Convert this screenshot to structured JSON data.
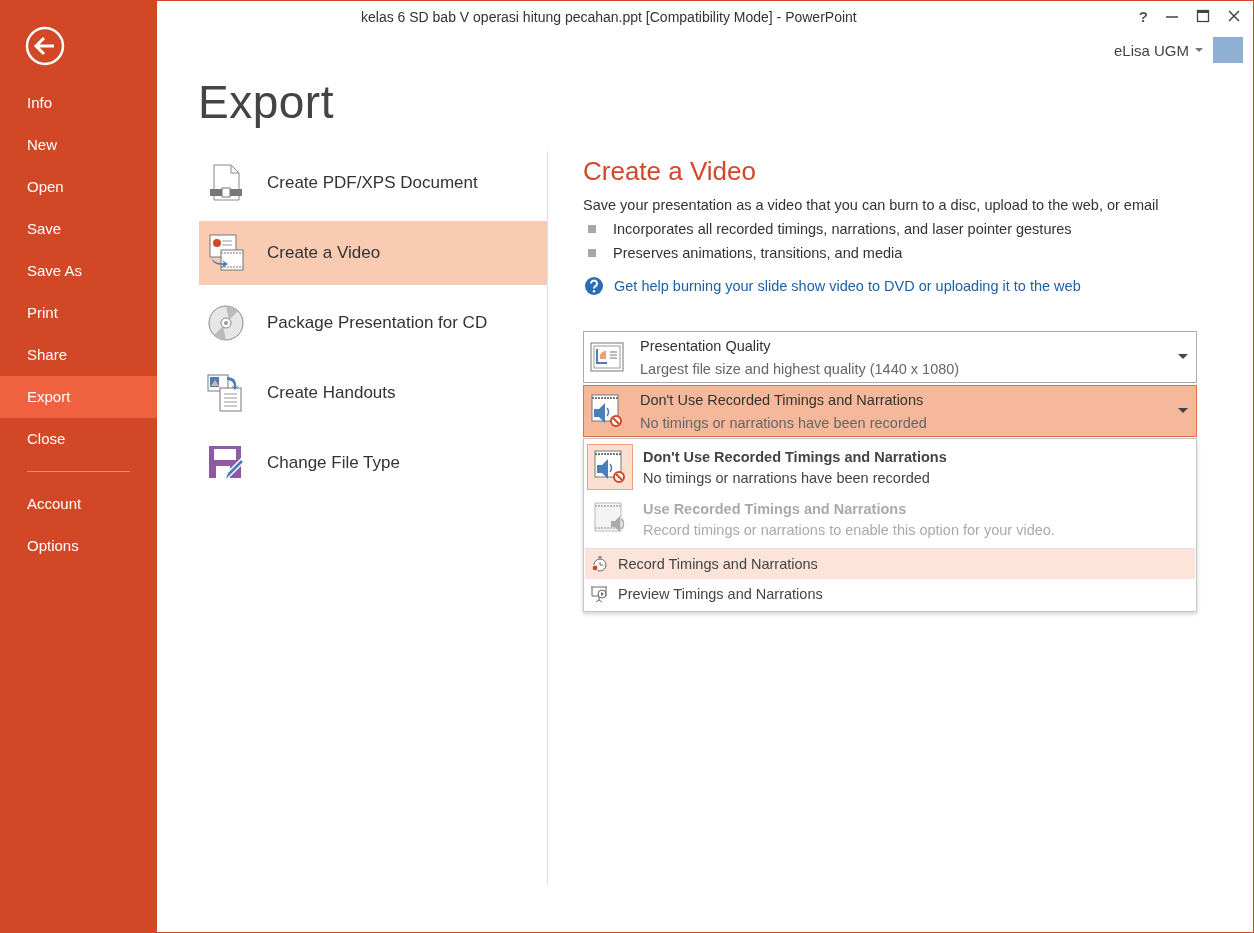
{
  "window": {
    "title": "kelas 6 SD bab V operasi hitung pecahan.ppt [Compatibility Mode] - PowerPoint",
    "help": "?",
    "user": "eLisa UGM"
  },
  "sidebar": {
    "items": [
      {
        "label": "Info",
        "selected": false
      },
      {
        "label": "New",
        "selected": false
      },
      {
        "label": "Open",
        "selected": false
      },
      {
        "label": "Save",
        "selected": false
      },
      {
        "label": "Save As",
        "selected": false
      },
      {
        "label": "Print",
        "selected": false
      },
      {
        "label": "Share",
        "selected": false
      },
      {
        "label": "Export",
        "selected": true
      },
      {
        "label": "Close",
        "selected": false
      }
    ],
    "bottom_items": [
      {
        "label": "Account",
        "selected": false
      },
      {
        "label": "Options",
        "selected": false
      }
    ]
  },
  "page_title": "Export",
  "export_options": [
    {
      "label": "Create PDF/XPS Document",
      "selected": false
    },
    {
      "label": "Create a Video",
      "selected": true
    },
    {
      "label": "Package Presentation for CD",
      "selected": false
    },
    {
      "label": "Create Handouts",
      "selected": false
    },
    {
      "label": "Change File Type",
      "selected": false
    }
  ],
  "detail": {
    "title": "Create a Video",
    "description": "Save your presentation as a video that you can burn to a disc, upload to the web, or email",
    "bullets": [
      "Incorporates all recorded timings, narrations, and laser pointer gestures",
      "Preserves animations, transitions, and media"
    ],
    "help_link": "Get help burning your slide show video to DVD or uploading it to the web",
    "dropdowns": [
      {
        "title": "Presentation Quality",
        "subtitle": "Largest file size and highest quality (1440 x 1080)",
        "open": false
      },
      {
        "title": "Don't Use Recorded Timings and Narrations",
        "subtitle": "No timings or narrations have been recorded",
        "open": true
      }
    ],
    "menu": [
      {
        "kind": "option",
        "title": "Don't Use Recorded Timings and Narrations",
        "subtitle": "No timings or narrations have been recorded",
        "selected": true,
        "disabled": false
      },
      {
        "kind": "option",
        "title": "Use Recorded Timings and Narrations",
        "subtitle": "Record timings or narrations to enable this option for your video.",
        "selected": false,
        "disabled": true
      },
      {
        "kind": "command",
        "title": "Record Timings and Narrations",
        "selected": true,
        "disabled": false
      },
      {
        "kind": "command",
        "title": "Preview Timings and Narrations",
        "selected": false,
        "disabled": false
      }
    ]
  }
}
